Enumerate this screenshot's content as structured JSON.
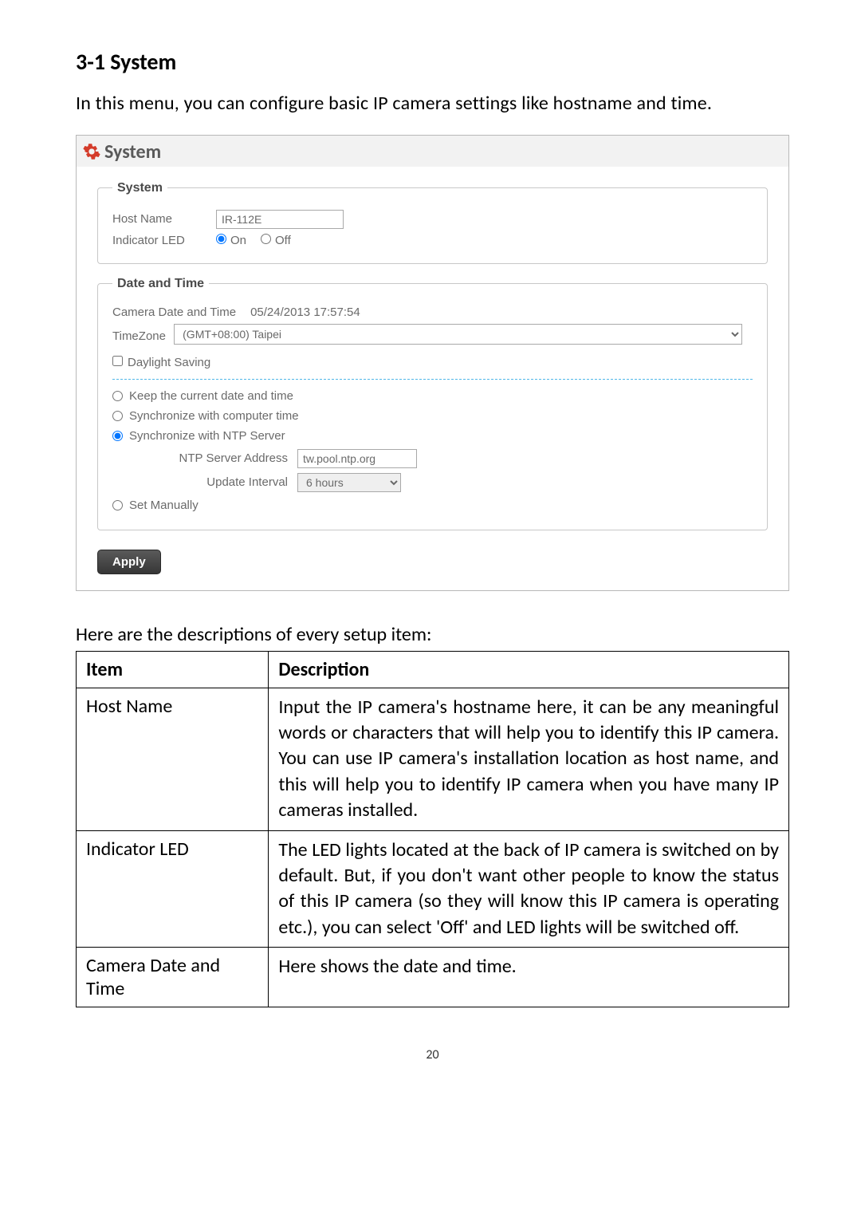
{
  "heading": "3-1 System",
  "intro": "In this menu, you can configure basic IP camera settings like hostname and time.",
  "frame": {
    "title": "System",
    "system_group": {
      "legend": "System",
      "host_name_label": "Host Name",
      "host_name_value": "IR-112E",
      "indicator_led_label": "Indicator LED",
      "indicator_on": "On",
      "indicator_off": "Off"
    },
    "datetime_group": {
      "legend": "Date and Time",
      "camera_label": "Camera Date and Time",
      "camera_value": "05/24/2013 17:57:54",
      "timezone_label": "TimeZone",
      "timezone_value": "(GMT+08:00) Taipei",
      "daylight_label": "Daylight Saving",
      "opt_keep": "Keep the current date and time",
      "opt_sync_computer": "Synchronize with computer time",
      "opt_sync_ntp": "Synchronize with NTP Server",
      "ntp_addr_label": "NTP Server Address",
      "ntp_addr_value": "tw.pool.ntp.org",
      "update_label": "Update Interval",
      "update_value": "6 hours",
      "opt_manual": "Set Manually"
    },
    "apply_label": "Apply"
  },
  "table_caption": "Here are the descriptions of every setup item:",
  "table": {
    "header_item": "Item",
    "header_desc": "Description",
    "rows": [
      {
        "item": "Host Name",
        "desc": "Input the IP camera's hostname here, it can be any meaningful words or characters that will help you to identify this IP camera. You can use IP camera's installation location as host name, and this will help you to identify IP camera when you have many IP cameras installed."
      },
      {
        "item": "Indicator LED",
        "desc": "The LED lights located at the back of IP camera is switched on by default. But, if you don't want other people to know the status of this IP camera (so they will know this IP camera is operating etc.), you can select 'Off' and LED lights will be switched off."
      },
      {
        "item": "Camera Date and Time",
        "desc": "Here shows the date and time."
      }
    ]
  },
  "page_number": "20"
}
